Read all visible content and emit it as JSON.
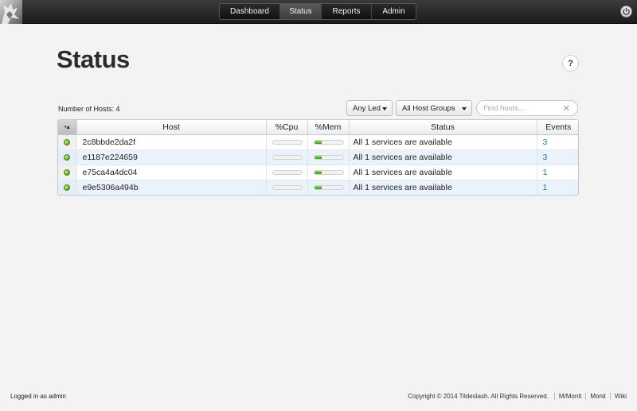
{
  "nav": {
    "items": [
      {
        "label": "Dashboard",
        "active": false
      },
      {
        "label": "Status",
        "active": true
      },
      {
        "label": "Reports",
        "active": false
      },
      {
        "label": "Admin",
        "active": false
      }
    ]
  },
  "page": {
    "title": "Status",
    "help": "?"
  },
  "filters": {
    "host_count": "Number of Hosts: 4",
    "led": "Any Led",
    "groups": "All Host Groups",
    "search_placeholder": "Find hosts...",
    "clear": "✕"
  },
  "table": {
    "columns": {
      "led": "•▴",
      "host": "Host",
      "cpu": "%Cpu",
      "mem": "%Mem",
      "status": "Status",
      "events": "Events"
    },
    "rows": [
      {
        "led": "green",
        "host": "2c8bbde2da2f",
        "cpu": 0,
        "mem": 25,
        "status": "All 1 services are available",
        "events": "3"
      },
      {
        "led": "green",
        "host": "e1187e224659",
        "cpu": 0,
        "mem": 25,
        "status": "All 1 services are available",
        "events": "3"
      },
      {
        "led": "green",
        "host": "e75ca4a4dc04",
        "cpu": 0,
        "mem": 25,
        "status": "All 1 services are available",
        "events": "1"
      },
      {
        "led": "green",
        "host": "e9e5306a494b",
        "cpu": 0,
        "mem": 25,
        "status": "All 1 services are available",
        "events": "1"
      }
    ]
  },
  "footer": {
    "logged_in": "Logged in as admin",
    "copyright": "Copyright © 2014 Tildeslash. All Rights Reserved.",
    "links": [
      "M/Monit",
      "Monit",
      "Wiki"
    ]
  },
  "colors": {
    "led_green": "#5aa51d",
    "events_link": "#1b7bc4",
    "bar_fill": "#34a11f"
  }
}
